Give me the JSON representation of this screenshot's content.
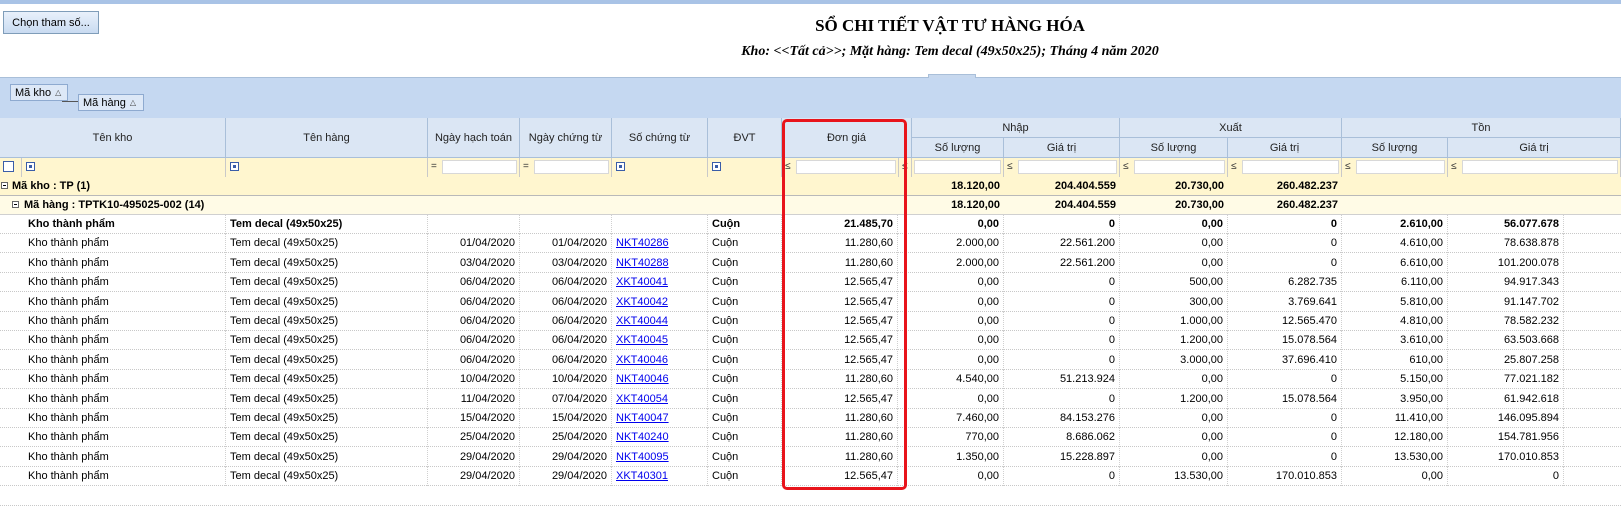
{
  "toolbar": {
    "choose_params_label": "Chọn tham số..."
  },
  "report": {
    "title": "SỔ CHI TIẾT VẬT TƯ HÀNG HÓA",
    "subtitle": "Kho: <<Tất cả>>; Mặt hàng: Tem decal (49x50x25); Tháng 4 năm 2020"
  },
  "group_panel": {
    "group1": "Mã kho",
    "group2": "Mã hàng"
  },
  "columns": {
    "ten_kho": "Tên kho",
    "ten_hang": "Tên hàng",
    "ngay_hach_toan": "Ngày hạch toán",
    "ngay_chung_tu": "Ngày chứng từ",
    "so_chung_tu": "Số chứng từ",
    "dvt": "ĐVT",
    "don_gia": "Đơn giá",
    "nhap": "Nhập",
    "xuat": "Xuất",
    "ton": "Tồn",
    "so_luong": "Số lượng",
    "gia_tri": "Giá trị"
  },
  "filter_ops": {
    "eq": "=",
    "le": "≤"
  },
  "group_rows": {
    "kho": {
      "label": "Mã kho : TP (1)",
      "nhap_sl": "18.120,00",
      "nhap_gt": "204.404.559",
      "xuat_sl": "20.730,00",
      "xuat_gt": "260.482.237"
    },
    "hang": {
      "label": "Mã hàng : TPTK10-495025-002 (14)",
      "nhap_sl": "18.120,00",
      "nhap_gt": "204.404.559",
      "xuat_sl": "20.730,00",
      "xuat_gt": "260.482.237"
    }
  },
  "rows": [
    {
      "kho": "Kho thành phẩm",
      "hang": "Tem decal (49x50x25)",
      "nht": "",
      "nct": "",
      "sct": "",
      "dvt": "Cuộn",
      "dg": "21.485,70",
      "nsl": "0,00",
      "ngt": "0",
      "xsl": "0,00",
      "xgt": "0",
      "tsl": "2.610,00",
      "tgt": "56.077.678"
    },
    {
      "kho": "Kho thành phẩm",
      "hang": "Tem decal (49x50x25)",
      "nht": "01/04/2020",
      "nct": "01/04/2020",
      "sct": "NKT40286",
      "dvt": "Cuộn",
      "dg": "11.280,60",
      "nsl": "2.000,00",
      "ngt": "22.561.200",
      "xsl": "0,00",
      "xgt": "0",
      "tsl": "4.610,00",
      "tgt": "78.638.878"
    },
    {
      "kho": "Kho thành phẩm",
      "hang": "Tem decal (49x50x25)",
      "nht": "03/04/2020",
      "nct": "03/04/2020",
      "sct": "NKT40288",
      "dvt": "Cuộn",
      "dg": "11.280,60",
      "nsl": "2.000,00",
      "ngt": "22.561.200",
      "xsl": "0,00",
      "xgt": "0",
      "tsl": "6.610,00",
      "tgt": "101.200.078"
    },
    {
      "kho": "Kho thành phẩm",
      "hang": "Tem decal (49x50x25)",
      "nht": "06/04/2020",
      "nct": "06/04/2020",
      "sct": "XKT40041",
      "dvt": "Cuộn",
      "dg": "12.565,47",
      "nsl": "0,00",
      "ngt": "0",
      "xsl": "500,00",
      "xgt": "6.282.735",
      "tsl": "6.110,00",
      "tgt": "94.917.343"
    },
    {
      "kho": "Kho thành phẩm",
      "hang": "Tem decal (49x50x25)",
      "nht": "06/04/2020",
      "nct": "06/04/2020",
      "sct": "XKT40042",
      "dvt": "Cuộn",
      "dg": "12.565,47",
      "nsl": "0,00",
      "ngt": "0",
      "xsl": "300,00",
      "xgt": "3.769.641",
      "tsl": "5.810,00",
      "tgt": "91.147.702"
    },
    {
      "kho": "Kho thành phẩm",
      "hang": "Tem decal (49x50x25)",
      "nht": "06/04/2020",
      "nct": "06/04/2020",
      "sct": "XKT40044",
      "dvt": "Cuộn",
      "dg": "12.565,47",
      "nsl": "0,00",
      "ngt": "0",
      "xsl": "1.000,00",
      "xgt": "12.565.470",
      "tsl": "4.810,00",
      "tgt": "78.582.232"
    },
    {
      "kho": "Kho thành phẩm",
      "hang": "Tem decal (49x50x25)",
      "nht": "06/04/2020",
      "nct": "06/04/2020",
      "sct": "XKT40045",
      "dvt": "Cuộn",
      "dg": "12.565,47",
      "nsl": "0,00",
      "ngt": "0",
      "xsl": "1.200,00",
      "xgt": "15.078.564",
      "tsl": "3.610,00",
      "tgt": "63.503.668"
    },
    {
      "kho": "Kho thành phẩm",
      "hang": "Tem decal (49x50x25)",
      "nht": "06/04/2020",
      "nct": "06/04/2020",
      "sct": "XKT40046",
      "dvt": "Cuộn",
      "dg": "12.565,47",
      "nsl": "0,00",
      "ngt": "0",
      "xsl": "3.000,00",
      "xgt": "37.696.410",
      "tsl": "610,00",
      "tgt": "25.807.258"
    },
    {
      "kho": "Kho thành phẩm",
      "hang": "Tem decal (49x50x25)",
      "nht": "10/04/2020",
      "nct": "10/04/2020",
      "sct": "NKT40046",
      "dvt": "Cuộn",
      "dg": "11.280,60",
      "nsl": "4.540,00",
      "ngt": "51.213.924",
      "xsl": "0,00",
      "xgt": "0",
      "tsl": "5.150,00",
      "tgt": "77.021.182"
    },
    {
      "kho": "Kho thành phẩm",
      "hang": "Tem decal (49x50x25)",
      "nht": "11/04/2020",
      "nct": "07/04/2020",
      "sct": "XKT40054",
      "dvt": "Cuộn",
      "dg": "12.565,47",
      "nsl": "0,00",
      "ngt": "0",
      "xsl": "1.200,00",
      "xgt": "15.078.564",
      "tsl": "3.950,00",
      "tgt": "61.942.618"
    },
    {
      "kho": "Kho thành phẩm",
      "hang": "Tem decal (49x50x25)",
      "nht": "15/04/2020",
      "nct": "15/04/2020",
      "sct": "NKT40047",
      "dvt": "Cuộn",
      "dg": "11.280,60",
      "nsl": "7.460,00",
      "ngt": "84.153.276",
      "xsl": "0,00",
      "xgt": "0",
      "tsl": "11.410,00",
      "tgt": "146.095.894"
    },
    {
      "kho": "Kho thành phẩm",
      "hang": "Tem decal (49x50x25)",
      "nht": "25/04/2020",
      "nct": "25/04/2020",
      "sct": "NKT40240",
      "dvt": "Cuộn",
      "dg": "11.280,60",
      "nsl": "770,00",
      "ngt": "8.686.062",
      "xsl": "0,00",
      "xgt": "0",
      "tsl": "12.180,00",
      "tgt": "154.781.956"
    },
    {
      "kho": "Kho thành phẩm",
      "hang": "Tem decal (49x50x25)",
      "nht": "29/04/2020",
      "nct": "29/04/2020",
      "sct": "NKT40095",
      "dvt": "Cuộn",
      "dg": "11.280,60",
      "nsl": "1.350,00",
      "ngt": "15.228.897",
      "xsl": "0,00",
      "xgt": "0",
      "tsl": "13.530,00",
      "tgt": "170.010.853"
    },
    {
      "kho": "Kho thành phẩm",
      "hang": "Tem decal (49x50x25)",
      "nht": "29/04/2020",
      "nct": "29/04/2020",
      "sct": "XKT40301",
      "dvt": "Cuộn",
      "dg": "12.565,47",
      "nsl": "0,00",
      "ngt": "0",
      "xsl": "13.530,00",
      "xgt": "170.010.853",
      "tsl": "0,00",
      "tgt": "0"
    }
  ]
}
